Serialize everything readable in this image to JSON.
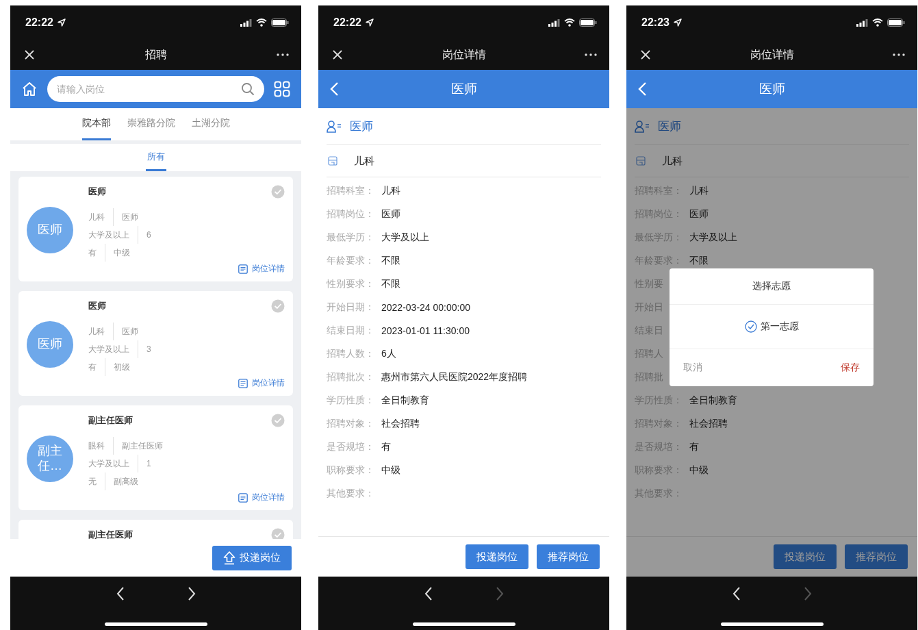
{
  "screens": [
    {
      "kind": "list",
      "dimmed": false,
      "time": "22:22",
      "title": "招聘",
      "search": {
        "placeholder": "请输入岗位"
      },
      "tabs": [
        {
          "label": "院本部",
          "selected": true
        },
        {
          "label": "崇雅路分院",
          "selected": false
        },
        {
          "label": "土湖分院",
          "selected": false
        }
      ],
      "subtabs": [
        {
          "label": "所有",
          "selected": true
        }
      ],
      "cards": [
        {
          "avatar": "医师",
          "title": "医师",
          "selected": false,
          "fields": [
            [
              "儿科",
              "医师"
            ],
            [
              "大学及以上",
              "6"
            ],
            [
              "有",
              "中级"
            ]
          ],
          "link": "岗位详情"
        },
        {
          "avatar": "医师",
          "title": "医师",
          "selected": false,
          "fields": [
            [
              "儿科",
              "医师"
            ],
            [
              "大学及以上",
              "3"
            ],
            [
              "有",
              "初级"
            ]
          ],
          "link": "岗位详情"
        },
        {
          "avatar": "副主任…",
          "title": "副主任医师",
          "selected": false,
          "fields": [
            [
              "眼科",
              "副主任医师"
            ],
            [
              "大学及以上",
              "1"
            ],
            [
              "无",
              "副高级"
            ]
          ],
          "link": "岗位详情"
        },
        {
          "title": "副主任医师",
          "selected": false
        }
      ],
      "actions": [
        {
          "label": "投递岗位"
        }
      ],
      "nav": {
        "forward_disabled": false
      }
    },
    {
      "kind": "detail",
      "dimmed": false,
      "time": "22:22",
      "title": "岗位详情",
      "header": "医师",
      "position": "医师",
      "department": "儿科",
      "rows": [
        {
          "label": "招聘科室：",
          "value": "儿科"
        },
        {
          "label": "招聘岗位：",
          "value": "医师"
        },
        {
          "label": "最低学历：",
          "value": "大学及以上"
        },
        {
          "label": "年龄要求：",
          "value": "不限"
        },
        {
          "label": "性别要求：",
          "value": "不限"
        },
        {
          "label": "开始日期：",
          "value": "2022-03-24 00:00:00"
        },
        {
          "label": "结束日期：",
          "value": "2023-01-01 11:30:00"
        },
        {
          "label": "招聘人数：",
          "value": "6人"
        },
        {
          "label": "招聘批次：",
          "value": "惠州市第六人民医院2022年度招聘"
        },
        {
          "label": "学历性质：",
          "value": "全日制教育"
        },
        {
          "label": "招聘对象：",
          "value": "社会招聘"
        },
        {
          "label": "是否规培：",
          "value": "有"
        },
        {
          "label": "职称要求：",
          "value": "中级"
        },
        {
          "label": "其他要求："
        }
      ],
      "actions": [
        {
          "label": "投递岗位"
        },
        {
          "label": "推荐岗位"
        }
      ],
      "nav": {
        "forward_disabled": true
      }
    },
    {
      "kind": "detail",
      "dimmed": true,
      "time": "22:23",
      "title": "岗位详情",
      "header": "医师",
      "position": "医师",
      "department": "儿科",
      "rows": [
        {
          "label": "招聘科室：",
          "value": "儿科"
        },
        {
          "label": "招聘岗位：",
          "value": "医师"
        },
        {
          "label": "最低学历：",
          "value": "大学及以上"
        },
        {
          "label": "年龄要求：",
          "value": "不限"
        },
        {
          "label": "性别要"
        },
        {
          "label": "开始日"
        },
        {
          "label": "结束日"
        },
        {
          "label": "招聘人"
        },
        {
          "label": "招聘批"
        },
        {
          "label": "学历性质：",
          "value": "全日制教育"
        },
        {
          "label": "招聘对象：",
          "value": "社会招聘"
        },
        {
          "label": "是否规培：",
          "value": "有"
        },
        {
          "label": "职称要求：",
          "value": "中级"
        },
        {
          "label": "其他要求："
        }
      ],
      "actions": [
        {
          "label": "投递岗位"
        },
        {
          "label": "推荐岗位"
        }
      ],
      "nav": {
        "forward_disabled": true
      },
      "dialog": {
        "title": "选择志愿",
        "options": [
          {
            "label": "第一志愿",
            "selected": true
          }
        ],
        "cancel": "取消",
        "save": "保存"
      }
    }
  ]
}
